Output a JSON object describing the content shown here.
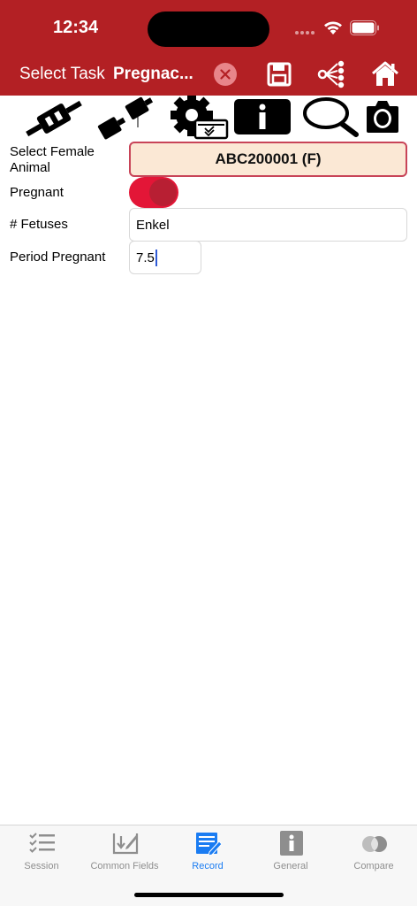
{
  "status": {
    "time": "12:34"
  },
  "nav": {
    "label": "Select Task",
    "value": "Pregnac..."
  },
  "toolbar": {
    "tools": [
      "scan-connected-icon",
      "scan-disconnected-icon",
      "settings-list-icon",
      "info-icon",
      "search-icon",
      "camera-icon"
    ]
  },
  "form": {
    "female_label": "Select Female Animal",
    "female_value": "ABC200001 (F)",
    "pregnant_label": "Pregnant",
    "pregnant_on": true,
    "fetuses_label": "# Fetuses",
    "fetuses_value": "Enkel",
    "period_label": "Period Pregnant",
    "period_value": "7.5"
  },
  "tabbar": {
    "tabs": [
      {
        "label": "Session",
        "icon": "checklist-icon",
        "active": false
      },
      {
        "label": "Common Fields",
        "icon": "edit-download-icon",
        "active": false
      },
      {
        "label": "Record",
        "icon": "record-edit-icon",
        "active": true
      },
      {
        "label": "General",
        "icon": "info-icon",
        "active": false
      },
      {
        "label": "Compare",
        "icon": "compare-circles-icon",
        "active": false
      }
    ]
  },
  "colors": {
    "header": "#b32024",
    "toggle_on": "#e31637",
    "animal_button_bg": "#fbe8d5",
    "active_tab": "#1a7cf2"
  }
}
